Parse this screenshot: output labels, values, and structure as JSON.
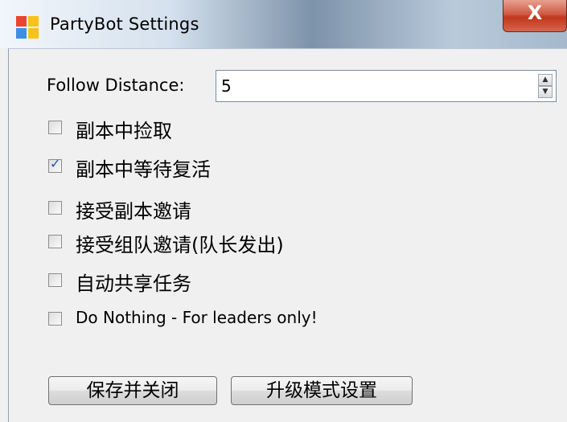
{
  "window": {
    "title": "PartyBot Settings",
    "close_label": "X"
  },
  "follow_distance": {
    "label": "Follow Distance:",
    "value": "5"
  },
  "options": [
    {
      "label": "副本中捡取",
      "checked": false
    },
    {
      "label": "副本中等待复活",
      "checked": true
    },
    {
      "label": "接受副本邀请",
      "checked": false
    },
    {
      "label": "接受组队邀请(队长发出)",
      "checked": false
    },
    {
      "label": "自动共享任务",
      "checked": false
    },
    {
      "label": "Do Nothing - For leaders only!",
      "checked": false
    }
  ],
  "buttons": {
    "save_close": "保存并关闭",
    "upgrade_settings": "升级模式设置"
  },
  "check_mark": "✓",
  "icons": {
    "app": "app-window-icon",
    "close": "close-icon",
    "spin_up": "spin-up-arrow-icon",
    "spin_down": "spin-down-arrow-icon"
  }
}
